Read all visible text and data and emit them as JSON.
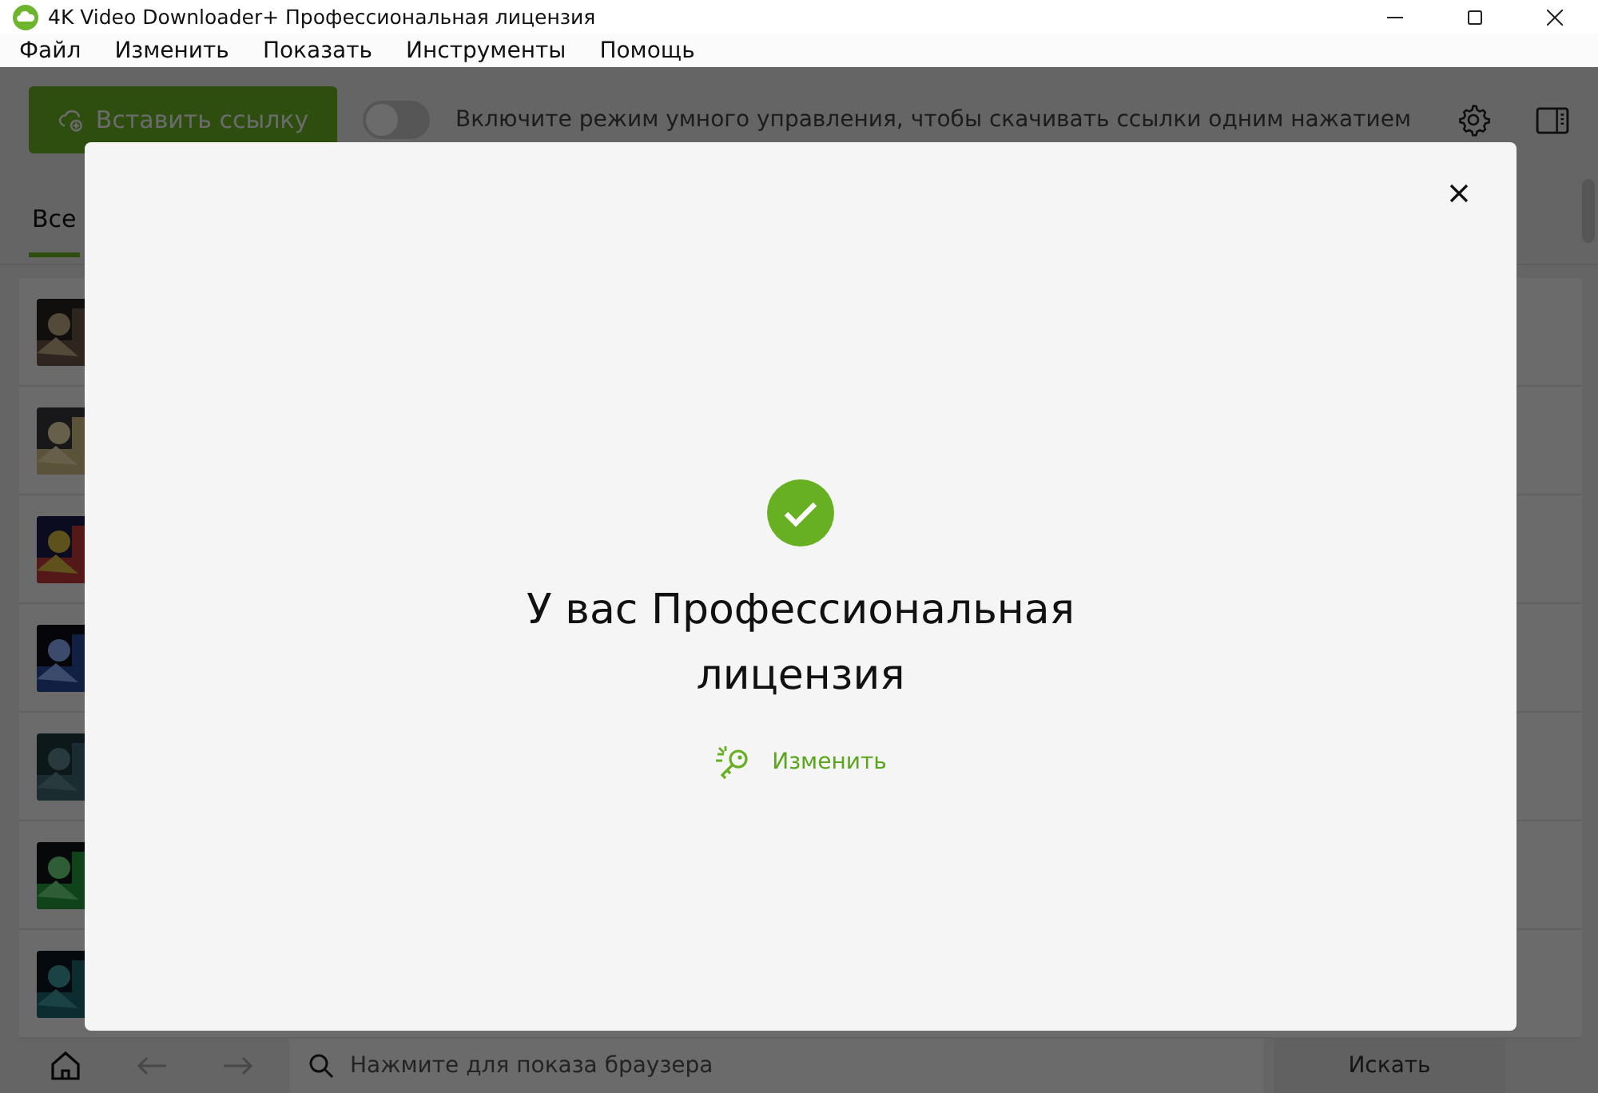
{
  "window": {
    "title": "4K Video Downloader+ Профессиональная лицензия"
  },
  "menu": [
    "Файл",
    "Изменить",
    "Показать",
    "Инструменты",
    "Помощь"
  ],
  "toolbar": {
    "paste_button": "Вставить ссылку",
    "smart_mode": {
      "on": false
    },
    "hint": "Включите режим умного управления, чтобы скачивать ссылки одним нажатием"
  },
  "tabs": [
    {
      "label": "Все",
      "selected": true
    }
  ],
  "bottom_bar": {
    "search": {
      "placeholder": "Нажмите для показа браузера"
    },
    "search_button": "Искать"
  },
  "dialog": {
    "title": "У вас Профессиональная лицензия",
    "action": "Изменить"
  }
}
